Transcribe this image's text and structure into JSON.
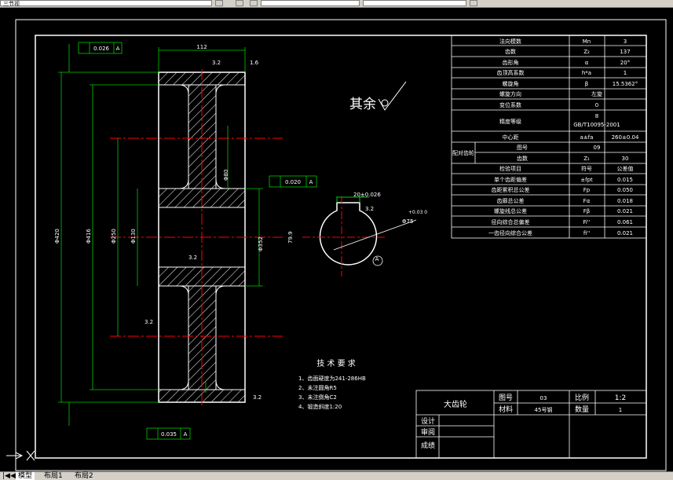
{
  "toolbar": {
    "combo1": "三节视",
    "combo2": "",
    "combo3": ""
  },
  "params": [
    {
      "name": "法向模数",
      "sym": "Mn",
      "val": "3"
    },
    {
      "name": "齿数",
      "sym": "Z₂",
      "val": "137"
    },
    {
      "name": "齿形角",
      "sym": "α",
      "val": "20°"
    },
    {
      "name": "齿顶高系数",
      "sym": "h*a",
      "val": "1"
    },
    {
      "name": "螺旋角",
      "sym": "β",
      "val": "15.5362°"
    },
    {
      "name": "螺旋方向",
      "sym": "",
      "val": "左旋"
    },
    {
      "name": "变位系数",
      "sym": "",
      "val": "0"
    }
  ],
  "precision": {
    "label": "精度等级",
    "val1": "8",
    "val2": "GB/T10095-2001"
  },
  "center": {
    "label": "中心距",
    "sym": "a±fa",
    "val": "260±0.04"
  },
  "mating": {
    "label": "配对齿轮",
    "row1_name": "图号",
    "row1_val": "09",
    "row2_name": "齿数",
    "row2_sym": "Z₁",
    "row2_val": "30"
  },
  "inspect_header": {
    "name": "检验项目",
    "sym": "符号",
    "val": "公差值"
  },
  "inspect": [
    {
      "name": "单个齿距偏差",
      "sym": "±fpt",
      "val": "0.015"
    },
    {
      "name": "齿距累积总公差",
      "sym": "Fp",
      "val": "0.050"
    },
    {
      "name": "齿廓总公差",
      "sym": "Fα",
      "val": "0.018"
    },
    {
      "name": "螺旋线总公差",
      "sym": "Fβ",
      "val": "0.021"
    },
    {
      "name": "径向综合总偏差",
      "sym": "Fi''",
      "val": "0.061"
    },
    {
      "name": "一齿径向综合公差",
      "sym": "fi''",
      "val": "0.021"
    }
  ],
  "roughness_note": "其余",
  "tech": {
    "title": "技 术 要 求",
    "items": [
      "1、齿面硬度为241-286HB",
      "2、未注圆角R5",
      "3、未注倒角C2",
      "4、锻造斜度1:20"
    ]
  },
  "title_block": {
    "part_name": "大齿轮",
    "drawing_no_label": "图号",
    "drawing_no": "03",
    "material_label": "材料",
    "material": "45号钢",
    "scale_label": "比例",
    "scale": "1:2",
    "qty_label": "数量",
    "qty": "1",
    "design": "设计",
    "review": "审阅",
    "grade": "成绩"
  },
  "dims": {
    "top_width": "112",
    "chamfer1": "3.2",
    "chamfer2": "1.6",
    "tol_top": "0.026",
    "tol_bottom": "0.035",
    "tol_key": "0.020",
    "datum": "A",
    "keyway": "20±0.026",
    "bore": "Φ75",
    "d_outer": "Φ420",
    "d_pitch": "Φ416",
    "d_mid": "Φ250",
    "d_hub": "Φ130",
    "d_right": "Φ352",
    "d_small": "Φ80",
    "hub_len": "79.9",
    "key_tol": "+0.03 0",
    "rough": "3.2"
  },
  "tabs": [
    "模型",
    "布局1",
    "布局2"
  ]
}
